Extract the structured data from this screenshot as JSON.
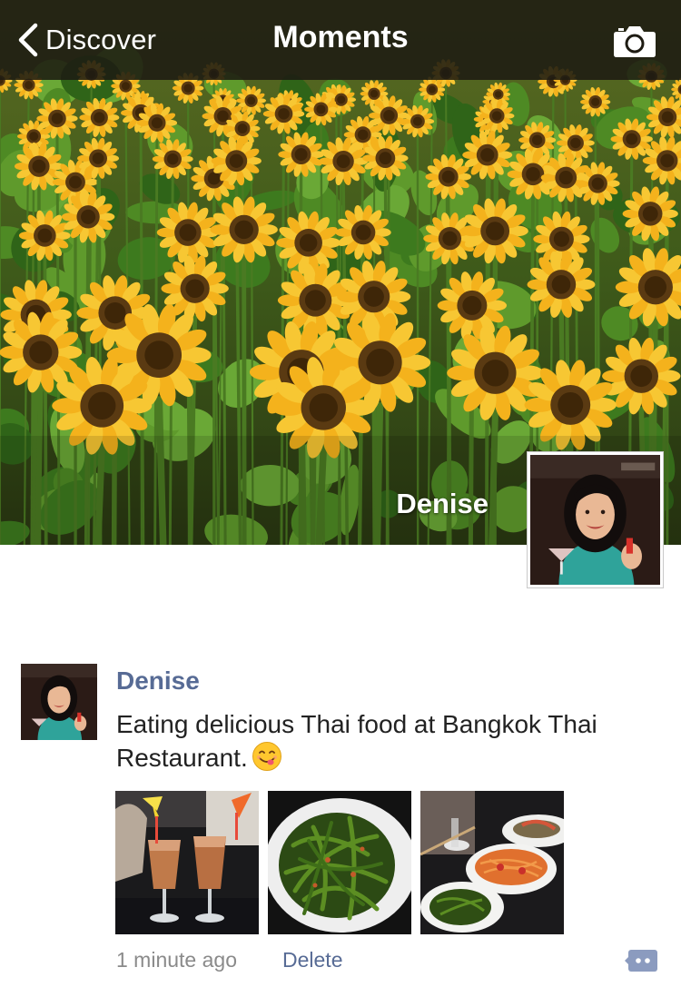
{
  "navbar": {
    "back_label": "Discover",
    "title": "Moments",
    "back_icon": "chevron-left-icon",
    "camera_icon": "camera-icon"
  },
  "profile": {
    "name": "Denise"
  },
  "post": {
    "author": "Denise",
    "text": "Eating delicious Thai food at Bangkok Thai Restaurant.",
    "emoji": "yum-face-emoji",
    "photos": [
      "thai-iced-tea-drinks",
      "stir-fried-greens",
      "papaya-salad-table"
    ],
    "timestamp": "1 minute ago",
    "delete_label": "Delete",
    "comment_icon": "comment-icon"
  },
  "colors": {
    "navbar_bg": "#1e1b12",
    "link_blue": "#576b95",
    "text_main": "#222222",
    "text_muted": "#8a8a8a",
    "sunflower_yellow": "#f4b21c"
  }
}
